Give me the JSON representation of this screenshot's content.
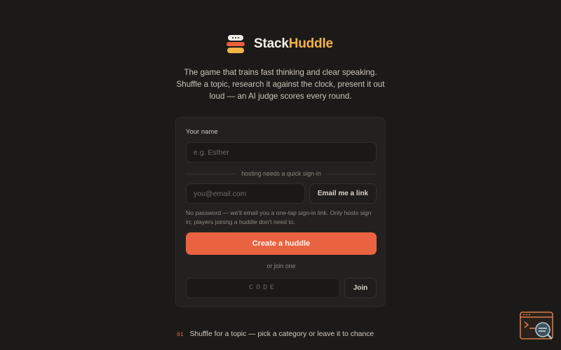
{
  "brand": {
    "name_part1": "Stack",
    "name_part2": "Huddle"
  },
  "tagline": "The game that trains fast thinking and clear speaking. Shuffle a topic, research it against the clock, present it out loud — an AI judge scores every round.",
  "form": {
    "name_label": "Your name",
    "name_placeholder": "e.g. Esther",
    "divider_text": "hosting needs a quick sign-in",
    "email_placeholder": "you@email.com",
    "email_button": "Email me a link",
    "note": "No password — we'll email you a one-tap sign-in link. Only hosts sign in; players joining a huddle don't need to.",
    "create_button": "Create a huddle",
    "or_text": "or join one",
    "code_placeholder": "CODE",
    "join_button": "Join"
  },
  "steps": [
    {
      "num": "01",
      "text": "Shuffle for a topic — pick a category or leave it to chance"
    }
  ],
  "colors": {
    "background": "#1c1a18",
    "card": "#232120",
    "accent": "#ea6340",
    "brand_yellow": "#f0b448"
  },
  "icons": {
    "widget": "terminal-search-icon"
  }
}
